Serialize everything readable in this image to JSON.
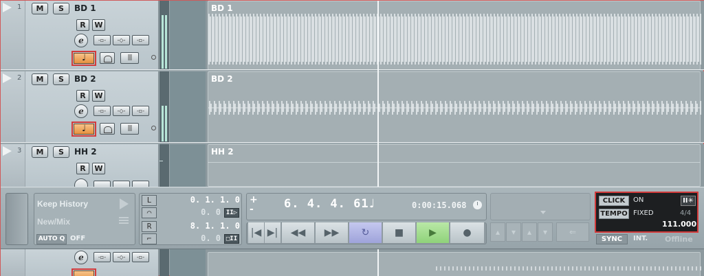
{
  "tracks": [
    {
      "number": "1",
      "name": "BD 1",
      "part_name": "BD 1",
      "mute": "M",
      "solo": "S",
      "read": "R",
      "write": "W",
      "edit": "e",
      "note": "♩",
      "grid": "|||"
    },
    {
      "number": "2",
      "name": "BD 2",
      "part_name": "BD 2",
      "mute": "M",
      "solo": "S",
      "read": "R",
      "write": "W",
      "edit": "e",
      "note": "♩",
      "grid": "|||"
    },
    {
      "number": "3",
      "name": "HH 2",
      "part_name": "HH 2",
      "mute": "M",
      "solo": "S",
      "read": "R",
      "write": "W"
    },
    {
      "edit": "e"
    }
  ],
  "history": {
    "keep_history": "Keep History",
    "new_mix": "New/Mix",
    "auto_q_label": "AUTO Q",
    "auto_q_value": "OFF"
  },
  "locators": {
    "left_value": "0. 1. 1.  0",
    "left_sub": "0.   0",
    "right_value": "8. 1. 1.  0",
    "right_sub": "0.   0",
    "left_icon": "L",
    "right_icon": "R",
    "btn_top": "II▷",
    "btn_bottom": "□II"
  },
  "position": {
    "bars_beats": "6. 4. 4.  61",
    "time": "0:00:15.068",
    "plus": "+",
    "minus": "-"
  },
  "transport_buttons": {
    "start": "|◀",
    "end": "▶|",
    "rewind": "◀◀",
    "forward": "▶▶",
    "loop": "↻",
    "stop": "■",
    "play": "▶",
    "record": "●"
  },
  "click": {
    "click_label": "CLICK",
    "click_value": "ON",
    "precount": "II✳",
    "tempo_label": "TEMPO",
    "tempo_mode": "FIXED",
    "signature": "4/4",
    "bpm": "111.000",
    "sync_label": "SYNC",
    "sync_source": "INT.",
    "sync_status": "Offline"
  },
  "colors": {
    "highlight": "#d23a3a",
    "note_button": "#f0a050",
    "play_active": "#8fd27a",
    "loop_active": "#9ea3da"
  }
}
